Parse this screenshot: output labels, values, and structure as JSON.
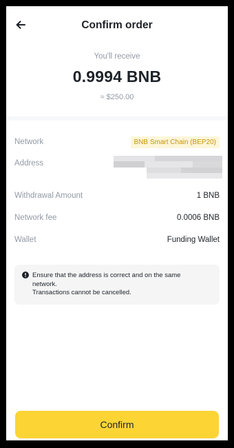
{
  "header": {
    "title": "Confirm order",
    "back_icon": "arrow-left-icon"
  },
  "summary": {
    "label": "You'll receive",
    "amount": "0.9994 BNB",
    "fiat": "≈ $250.00"
  },
  "details": {
    "network": {
      "label": "Network",
      "value": "BNB Smart Chain (BEP20)"
    },
    "address": {
      "label": "Address"
    },
    "withdrawal_amount": {
      "label": "Withdrawal Amount",
      "value": "1 BNB"
    },
    "network_fee": {
      "label": "Network fee",
      "value": "0.0006 BNB"
    },
    "wallet": {
      "label": "Wallet",
      "value": "Funding Wallet"
    }
  },
  "warning": {
    "icon": "exclamation-circle-icon",
    "line1": "Ensure that the address is correct and on the same network.",
    "line2": "Transactions cannot be cancelled."
  },
  "confirm_button": {
    "label": "Confirm"
  },
  "colors": {
    "accent": "#fcd535",
    "badge_bg": "#fdf6d8",
    "badge_text": "#c99400",
    "text_primary": "#1e2329",
    "text_secondary": "#929aa5"
  }
}
